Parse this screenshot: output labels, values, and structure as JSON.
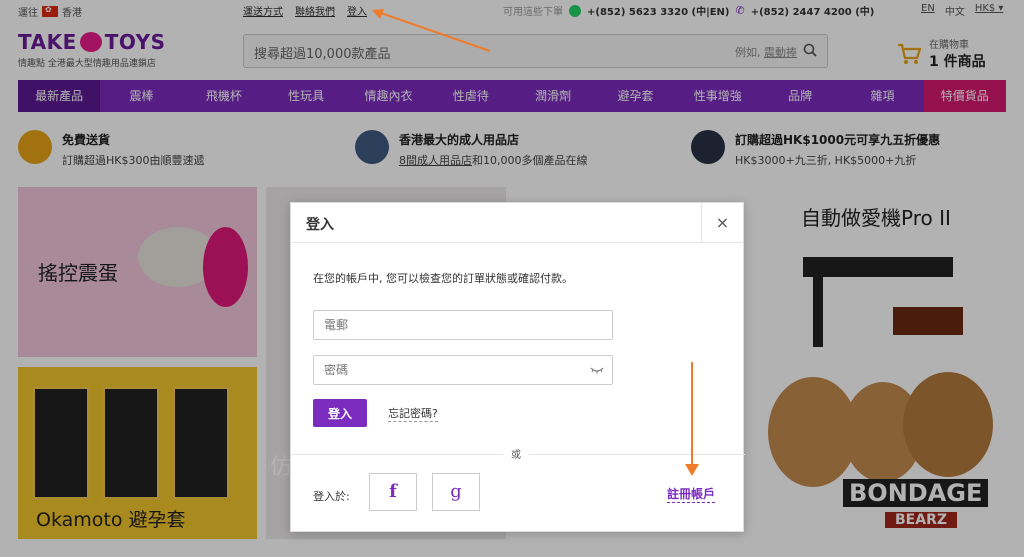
{
  "topbar": {
    "ship_label": "運往",
    "ship_region": "香港",
    "links": [
      "運送方式",
      "聯絡我們",
      "登入"
    ],
    "whatsapp_label": "可用這些下單",
    "phone1": "+(852) 5623 3320 (中|EN)",
    "phone2": "+(852) 2447 4200 (中)",
    "lang_en": "EN",
    "lang_zh": "中文",
    "currency": "HK$ ▾"
  },
  "header": {
    "brand": "TAKE TOYS",
    "brand_left": "TAKE",
    "brand_right": "TOYS",
    "tagline": "情趣點 全港最大型情趣用品連鎖店",
    "search_placeholder": "搜尋超過10,000款產品",
    "search_hint_prefix": "例如,",
    "search_hint_link": "震動捧",
    "cart_label": "在購物車",
    "cart_count": "1 件商品"
  },
  "nav": {
    "items": [
      "最新產品",
      "震棒",
      "飛機杯",
      "性玩具",
      "情趣內衣",
      "性虐待",
      "潤滑劑",
      "避孕套",
      "性事增強",
      "品牌",
      "雜項",
      "特價貨品"
    ]
  },
  "benefits": [
    {
      "title": "免費送貨",
      "sub": "訂購超過HK$300由順豐速遞"
    },
    {
      "title": "香港最大的成人用品店",
      "sub_link": "8間成人用品店",
      "sub_rest": "和10,000多個產品在線"
    },
    {
      "title": "訂購超過HK$1000元可享九五折優惠",
      "sub": "HK$3000+九三折, HK$5000+九折"
    }
  ],
  "banners": {
    "vibe_egg": "搖控震蛋",
    "condom": "Okamoto 避孕套",
    "machine": "自動做愛機Pro II",
    "bondage": "BONDAGE",
    "bondage_sub": "BEARZ",
    "middle_partial": "仿"
  },
  "modal": {
    "title": "登入",
    "close": "×",
    "intro": "在您的帳戶中, 您可以檢查您的訂單狀態或確認付款。",
    "email_placeholder": "電郵",
    "password_placeholder": "密碼",
    "login_button": "登入",
    "forgot": "忘記密碼?",
    "or": "或",
    "login_via": "登入於:",
    "facebook": "f",
    "google": "g",
    "register": "註冊帳戶"
  },
  "colors": {
    "brand_purple": "#7b2cbf",
    "sale_pink": "#d6196f"
  }
}
